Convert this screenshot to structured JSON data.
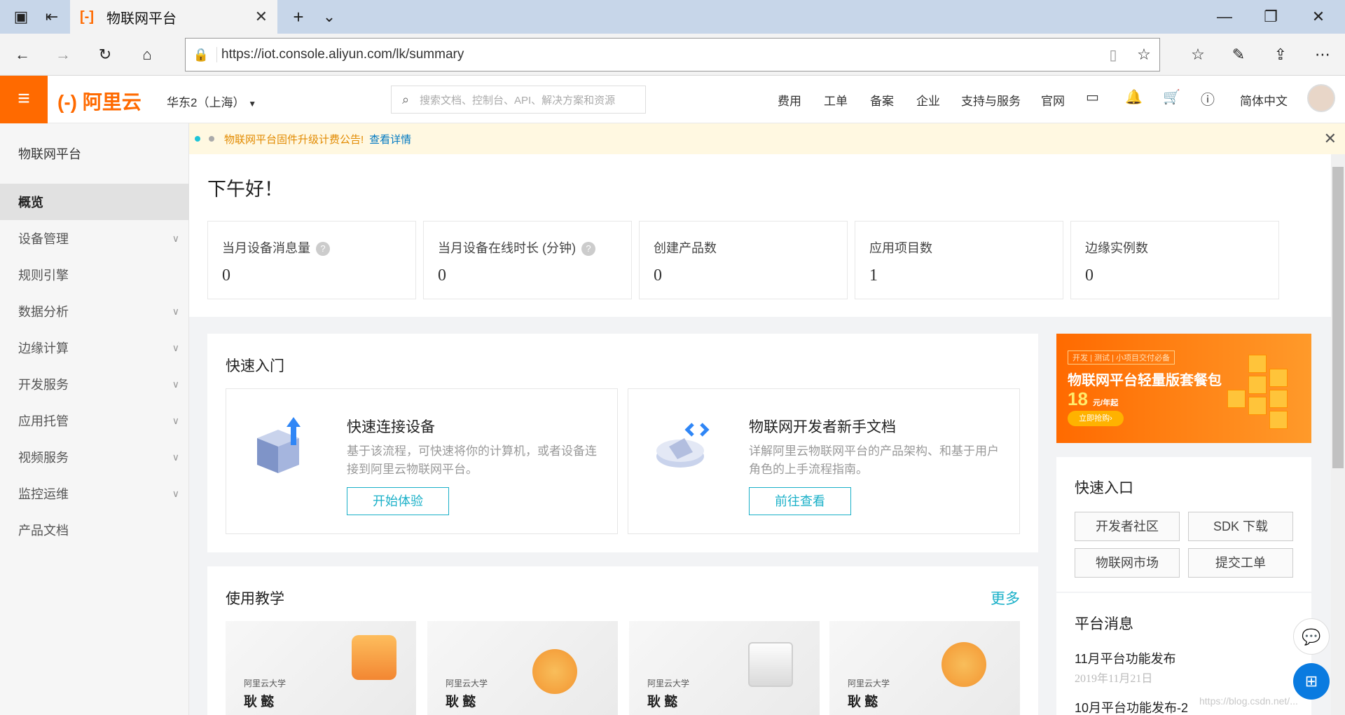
{
  "browser": {
    "tab_title": "物联网平台",
    "tab_favicon": "[-]",
    "url": "https://iot.console.aliyun.com/lk/summary"
  },
  "header": {
    "logo": "阿里云",
    "logo_mark": "(-)",
    "region": "华东2（上海）",
    "search_placeholder": "搜索文档、控制台、API、解决方案和资源",
    "nav": [
      "费用",
      "工单",
      "备案",
      "企业",
      "支持与服务",
      "官网"
    ],
    "language": "简体中文"
  },
  "sidebar": {
    "title": "物联网平台",
    "items": [
      {
        "label": "概览",
        "expandable": false
      },
      {
        "label": "设备管理",
        "expandable": true
      },
      {
        "label": "规则引擎",
        "expandable": false
      },
      {
        "label": "数据分析",
        "expandable": true
      },
      {
        "label": "边缘计算",
        "expandable": true
      },
      {
        "label": "开发服务",
        "expandable": true
      },
      {
        "label": "应用托管",
        "expandable": true
      },
      {
        "label": "视频服务",
        "expandable": true
      },
      {
        "label": "监控运维",
        "expandable": true
      },
      {
        "label": "产品文档",
        "expandable": false
      }
    ]
  },
  "notice": {
    "text": "物联网平台固件升级计费公告!",
    "link": "查看详情"
  },
  "greeting": "下午好！",
  "stats": [
    {
      "label": "当月设备消息量",
      "value": "0",
      "help": "?"
    },
    {
      "label": "当月设备在线时长 (分钟)",
      "value": "0",
      "help": "?"
    },
    {
      "label": "创建产品数",
      "value": "0"
    },
    {
      "label": "应用项目数",
      "value": "1"
    },
    {
      "label": "边缘实例数",
      "value": "0"
    }
  ],
  "quickstart": {
    "title": "快速入门",
    "cards": [
      {
        "title": "快速连接设备",
        "desc": "基于该流程，可快速将你的计算机，或者设备连接到阿里云物联网平台。",
        "button": "开始体验"
      },
      {
        "title": "物联网开发者新手文档",
        "desc": "详解阿里云物联网平台的产品架构、和基于用户角色的上手流程指南。",
        "button": "前往查看"
      }
    ]
  },
  "tutorials": {
    "title": "使用教学",
    "more": "更多",
    "cards": [
      {
        "brand": "阿里云大学",
        "author": "耿 懿"
      },
      {
        "brand": "阿里云大学",
        "author": "耿 懿"
      },
      {
        "brand": "阿里云大学",
        "author": "耿 懿"
      },
      {
        "brand": "阿里云大学",
        "author": "耿 懿"
      }
    ]
  },
  "banner": {
    "tag": "开发 | 测试 | 小项目交付必备",
    "title": "物联网平台轻量版套餐包",
    "price": "18",
    "price_unit": "元/年起",
    "button": "立即抢购›"
  },
  "quick_entry": {
    "title": "快速入口",
    "buttons": [
      "开发者社区",
      "SDK 下载",
      "物联网市场",
      "提交工单"
    ]
  },
  "messages": {
    "title": "平台消息",
    "items": [
      {
        "title": "11月平台功能发布",
        "date": "2019年11月21日"
      },
      {
        "title": "10月平台功能发布-2",
        "date": ""
      }
    ]
  },
  "watermark": "https://blog.csdn.net/..."
}
